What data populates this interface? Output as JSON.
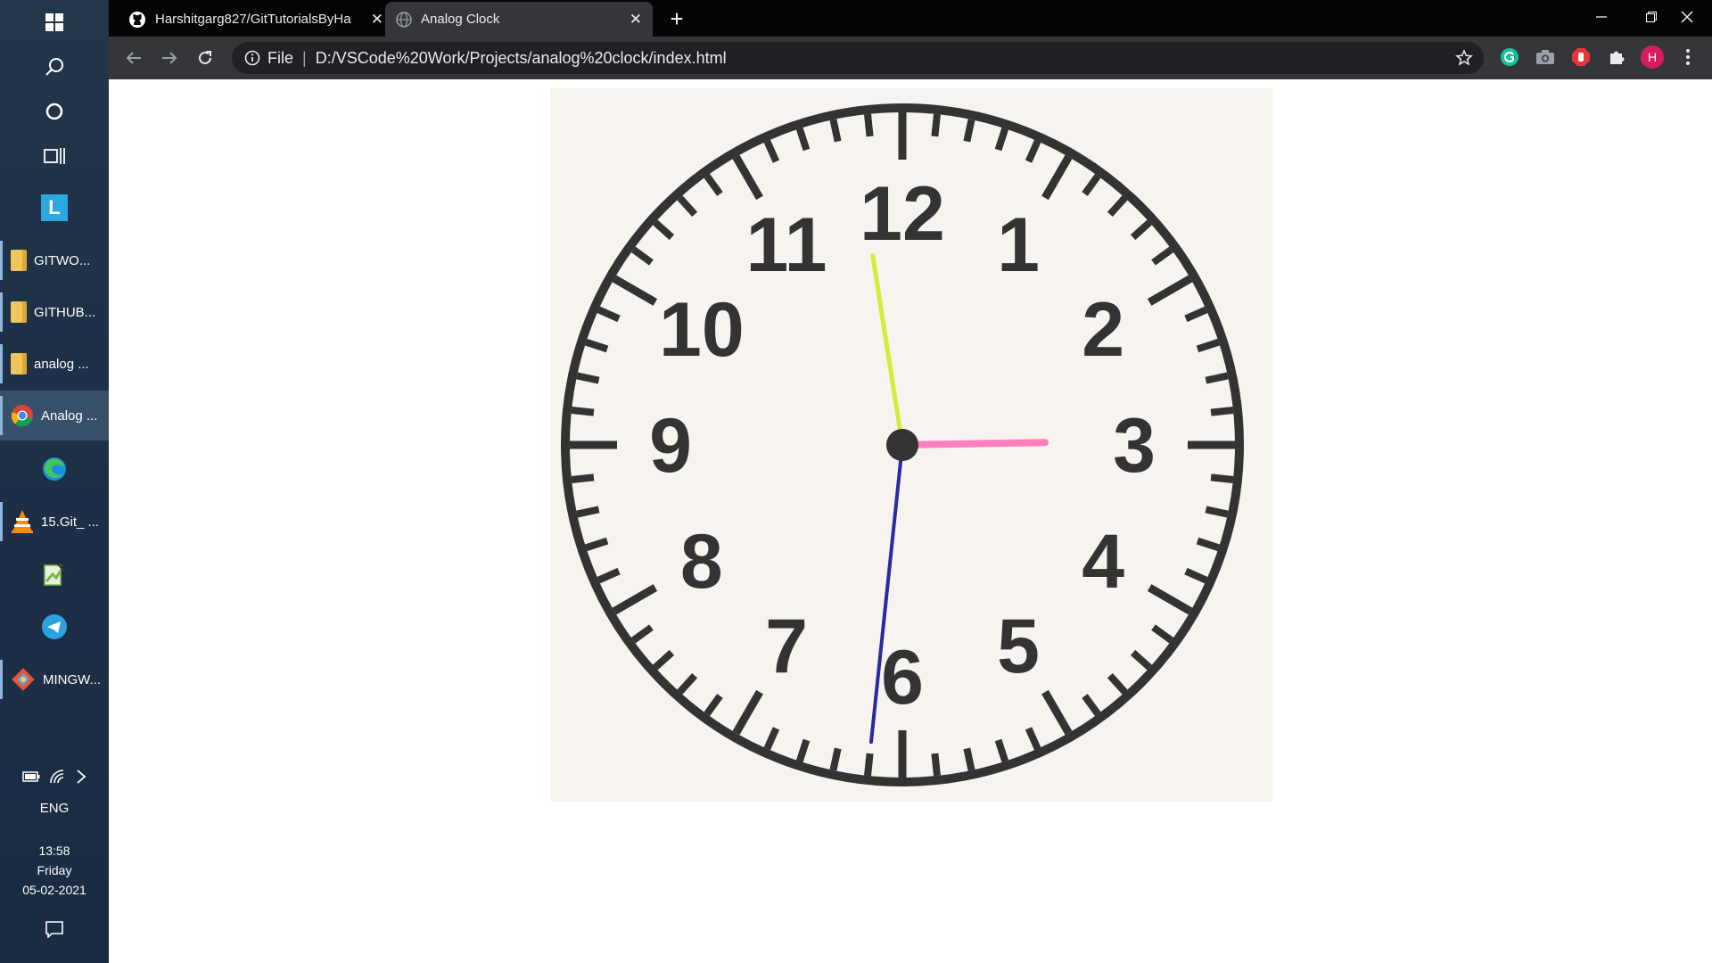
{
  "taskbar": {
    "apps": [
      {
        "label": "GITWO...",
        "icon": "folder-icon"
      },
      {
        "label": "GITHUB...",
        "icon": "folder-icon"
      },
      {
        "label": "analog ...",
        "icon": "folder-icon"
      },
      {
        "label": "Analog ...",
        "icon": "chrome-icon"
      },
      {
        "label": "15.Git_ ...",
        "icon": "vlc-icon"
      },
      {
        "label": "MINGW...",
        "icon": "git-icon"
      }
    ],
    "language": "ENG",
    "time": "13:58",
    "day": "Friday",
    "date": "05-02-2021"
  },
  "browser": {
    "tabs": [
      {
        "title": "Harshitgarg827/GitTutorialsByHa"
      },
      {
        "title": "Analog Clock"
      }
    ],
    "address": {
      "scheme_label": "File",
      "url": "D:/VSCode%20Work/Projects/analog%20clock/index.html"
    },
    "profile_initial": "H"
  },
  "clock": {
    "numerals": [
      "12",
      "1",
      "2",
      "3",
      "4",
      "5",
      "6",
      "7",
      "8",
      "9",
      "10",
      "11"
    ],
    "time_shown": {
      "hour": 2,
      "minute": 58,
      "second": 31
    },
    "colors": {
      "hour_hand": "#ff7fbf",
      "minute_hand": "#d4ec3c",
      "second_hand": "#2a2aa0",
      "face": "#333333"
    }
  }
}
